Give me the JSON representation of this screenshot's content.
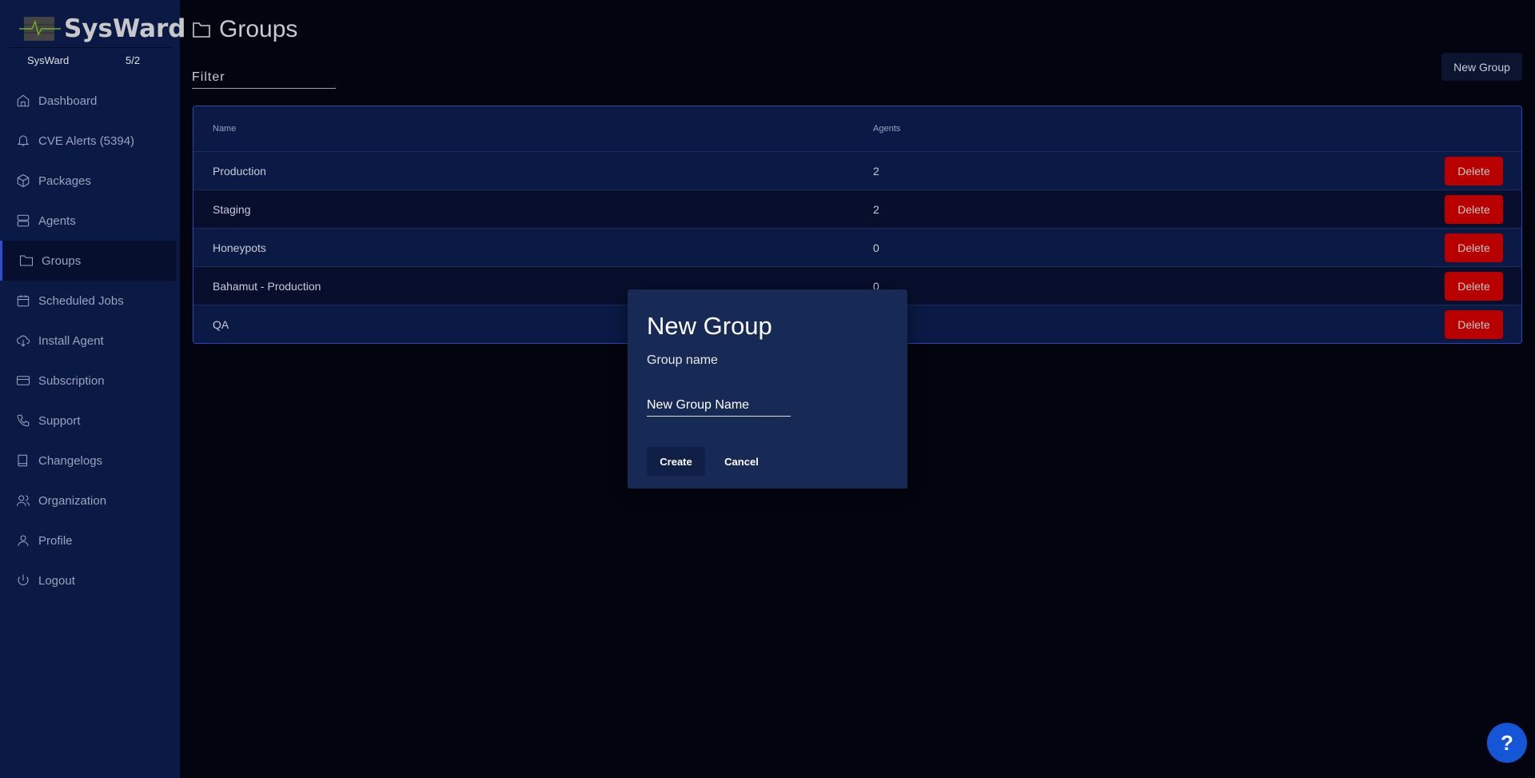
{
  "app": {
    "name": "SysWard"
  },
  "org": {
    "name": "SysWard",
    "count": "5/2"
  },
  "sidebar": {
    "items": [
      {
        "label": "Dashboard",
        "icon": "home-icon"
      },
      {
        "label": "CVE Alerts (5394)",
        "icon": "bell-icon"
      },
      {
        "label": "Packages",
        "icon": "box-icon"
      },
      {
        "label": "Agents",
        "icon": "server-icon"
      },
      {
        "label": "Groups",
        "icon": "folder-icon"
      },
      {
        "label": "Scheduled Jobs",
        "icon": "calendar-icon"
      },
      {
        "label": "Install Agent",
        "icon": "download-cloud-icon"
      },
      {
        "label": "Subscription",
        "icon": "credit-card-icon"
      },
      {
        "label": "Support",
        "icon": "phone-icon"
      },
      {
        "label": "Changelogs",
        "icon": "book-icon"
      },
      {
        "label": "Organization",
        "icon": "users-icon"
      },
      {
        "label": "Profile",
        "icon": "user-icon"
      },
      {
        "label": "Logout",
        "icon": "power-icon"
      }
    ]
  },
  "page": {
    "title": "Groups",
    "filter_placeholder": "Filter",
    "new_group_label": "New Group"
  },
  "table": {
    "headers": [
      "Name",
      "Agents"
    ],
    "delete_label": "Delete",
    "rows": [
      {
        "name": "Production",
        "agents": "2"
      },
      {
        "name": "Staging",
        "agents": "2"
      },
      {
        "name": "Honeypots",
        "agents": "0"
      },
      {
        "name": "Bahamut - Production",
        "agents": "0"
      },
      {
        "name": "QA",
        "agents": ""
      }
    ]
  },
  "dialog": {
    "title": "New Group",
    "label": "Group name",
    "value": "New Group Name",
    "create": "Create",
    "cancel": "Cancel"
  },
  "help": {
    "label": "?"
  }
}
